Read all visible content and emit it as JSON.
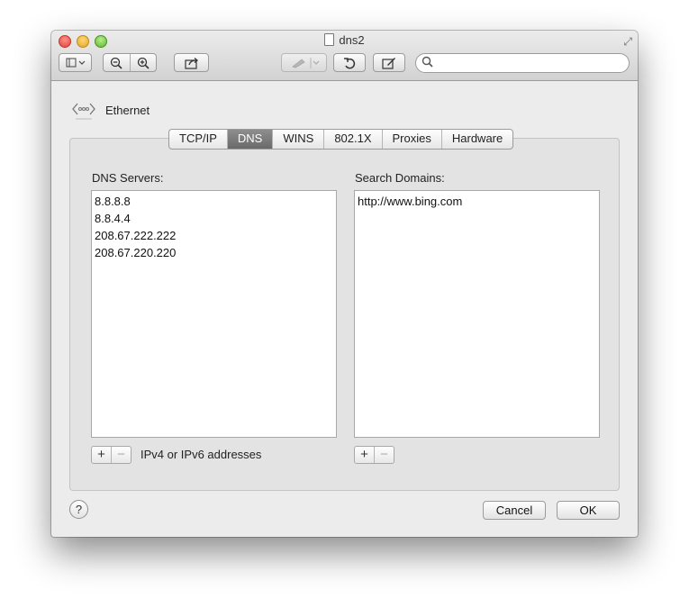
{
  "window": {
    "title": "dns2"
  },
  "toolbar": {
    "search_placeholder": ""
  },
  "service": {
    "label": "Ethernet"
  },
  "tabs": [
    {
      "label": "TCP/IP",
      "active": false
    },
    {
      "label": "DNS",
      "active": true
    },
    {
      "label": "WINS",
      "active": false
    },
    {
      "label": "802.1X",
      "active": false
    },
    {
      "label": "Proxies",
      "active": false
    },
    {
      "label": "Hardware",
      "active": false
    }
  ],
  "dns_servers": {
    "label": "DNS Servers:",
    "items": [
      "8.8.8.8",
      "8.8.4.4",
      "208.67.222.222",
      "208.67.220.220"
    ],
    "hint": "IPv4 or IPv6 addresses"
  },
  "search_domains": {
    "label": "Search Domains:",
    "items": [
      "http://www.bing.com"
    ]
  },
  "buttons": {
    "add": "+",
    "remove": "−",
    "help": "?",
    "cancel": "Cancel",
    "ok": "OK"
  }
}
